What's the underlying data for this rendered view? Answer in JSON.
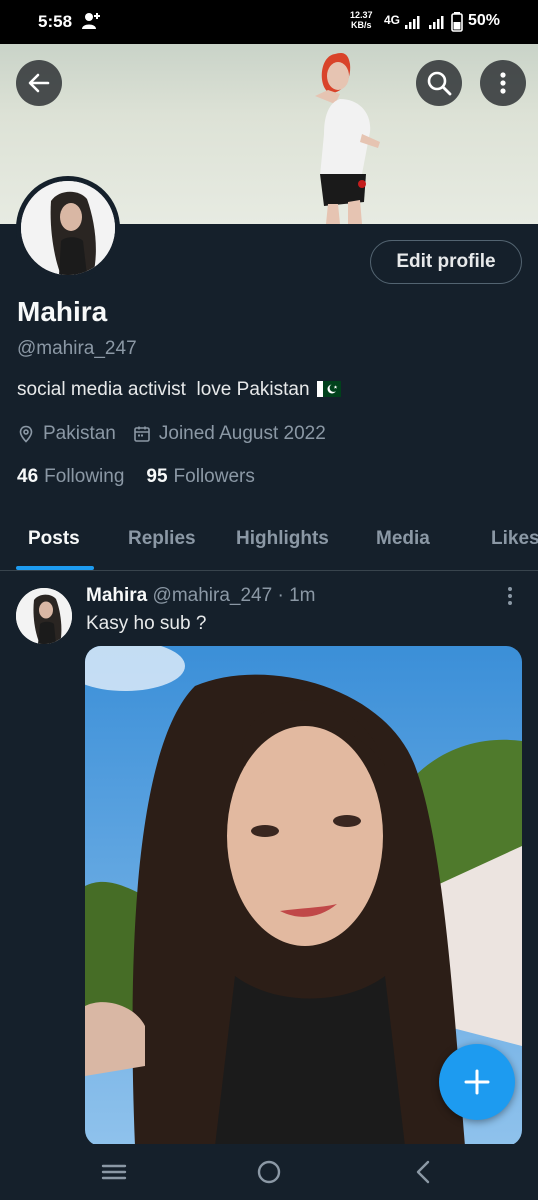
{
  "status_bar": {
    "time": "5:58",
    "speed_value": "12.37",
    "speed_unit": "KB/s",
    "network": "4G",
    "battery": "50%"
  },
  "profile": {
    "name": "Mahira",
    "handle": "@mahira_247",
    "bio": "social media activist  love Pakistan",
    "location": "Pakistan",
    "joined": "Joined August 2022",
    "following_count": "46",
    "following_label": "Following",
    "followers_count": "95",
    "followers_label": "Followers",
    "edit_label": "Edit profile"
  },
  "tabs": [
    {
      "label": "Posts",
      "active": true
    },
    {
      "label": "Replies",
      "active": false
    },
    {
      "label": "Highlights",
      "active": false
    },
    {
      "label": "Media",
      "active": false
    },
    {
      "label": "Likes",
      "active": false
    }
  ],
  "post": {
    "author_name": "Mahira",
    "author_handle": "@mahira_247",
    "separator": "·",
    "time": "1m",
    "text": "Kasy ho sub ?"
  },
  "icons": {
    "back": "back-arrow-icon",
    "search": "search-icon",
    "more": "more-vertical-icon",
    "location": "location-pin-icon",
    "calendar": "calendar-icon",
    "compose": "plus-icon",
    "flag": "pakistan-flag-icon"
  },
  "colors": {
    "background": "#15202b",
    "accent": "#1d9bf0",
    "secondary_text": "#8b98a5",
    "border": "#38444d"
  }
}
